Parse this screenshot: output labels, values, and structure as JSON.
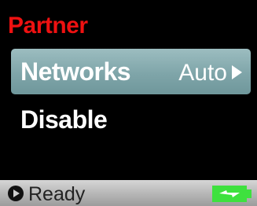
{
  "menu": {
    "title": "Partner",
    "title_color": "#ee1111",
    "items": [
      {
        "label": "Networks",
        "value": "Auto",
        "selected": true,
        "has_submenu": true
      },
      {
        "label": "Disable",
        "selected": false
      }
    ]
  },
  "status_bar": {
    "status_icon": "play-circle-icon",
    "status_text": "Ready",
    "battery_icon": "battery-charging-icon",
    "battery_color": "#3ee13e"
  }
}
